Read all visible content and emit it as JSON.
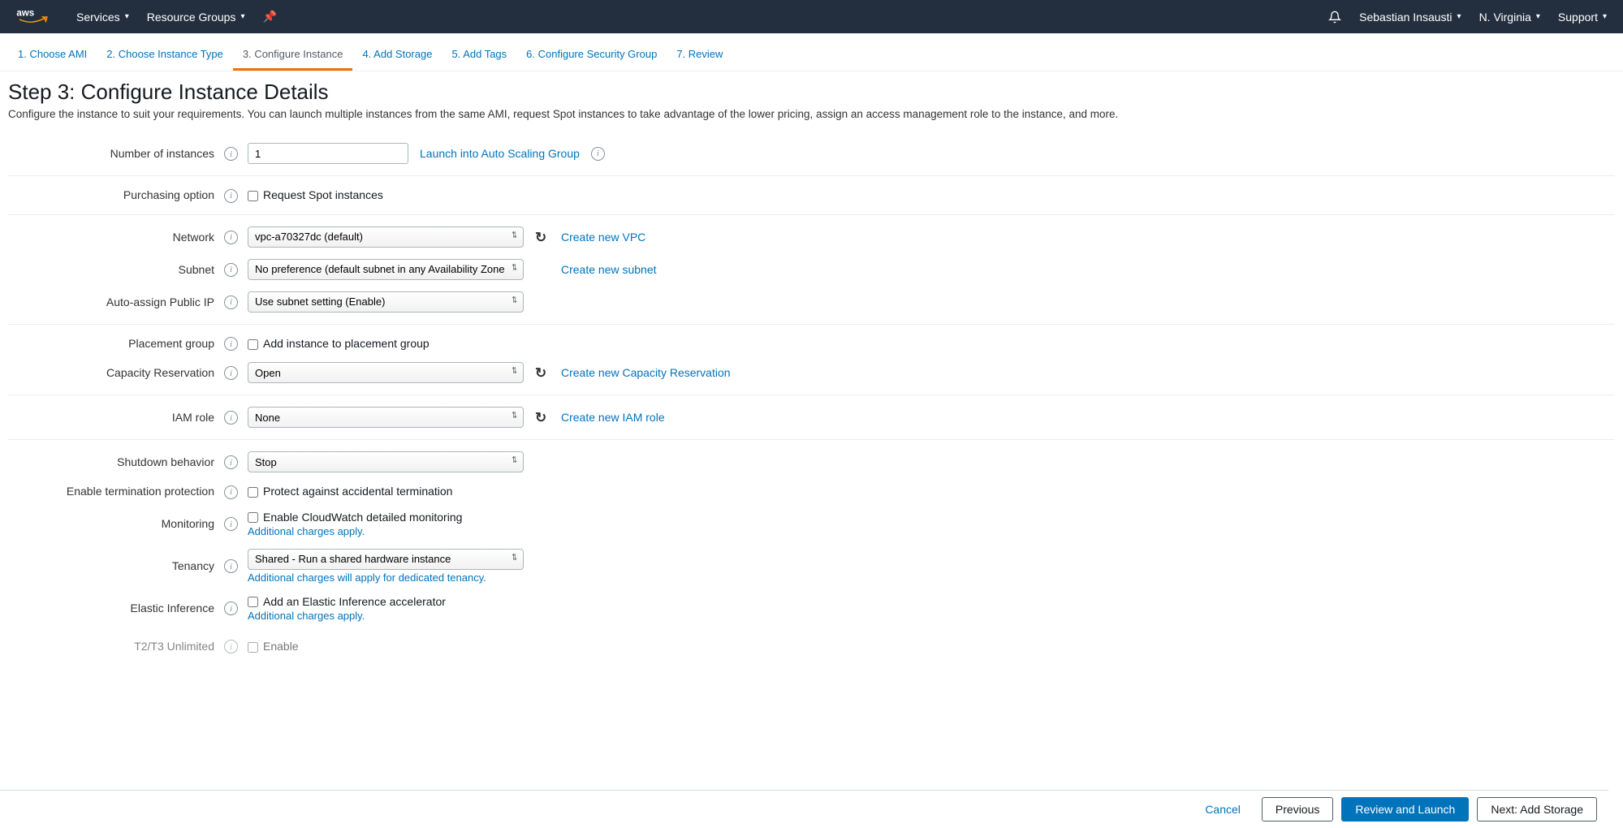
{
  "topbar": {
    "services_label": "Services",
    "resource_groups_label": "Resource Groups",
    "user_label": "Sebastian Insausti",
    "region_label": "N. Virginia",
    "support_label": "Support"
  },
  "wizard": {
    "tabs": [
      {
        "label": "1. Choose AMI"
      },
      {
        "label": "2. Choose Instance Type"
      },
      {
        "label": "3. Configure Instance"
      },
      {
        "label": "4. Add Storage"
      },
      {
        "label": "5. Add Tags"
      },
      {
        "label": "6. Configure Security Group"
      },
      {
        "label": "7. Review"
      }
    ]
  },
  "page": {
    "title": "Step 3: Configure Instance Details",
    "description": "Configure the instance to suit your requirements. You can launch multiple instances from the same AMI, request Spot instances to take advantage of the lower pricing, assign an access management role to the instance, and more."
  },
  "fields": {
    "num_instances": {
      "label": "Number of instances",
      "value": "1",
      "asg_link": "Launch into Auto Scaling Group"
    },
    "purchasing": {
      "label": "Purchasing option",
      "text": "Request Spot instances"
    },
    "network": {
      "label": "Network",
      "value": "vpc-a70327dc (default)",
      "link": "Create new VPC"
    },
    "subnet": {
      "label": "Subnet",
      "value": "No preference (default subnet in any Availability Zone)",
      "link": "Create new subnet"
    },
    "auto_ip": {
      "label": "Auto-assign Public IP",
      "value": "Use subnet setting (Enable)"
    },
    "placement": {
      "label": "Placement group",
      "text": "Add instance to placement group"
    },
    "capacity": {
      "label": "Capacity Reservation",
      "value": "Open",
      "link": "Create new Capacity Reservation"
    },
    "iam": {
      "label": "IAM role",
      "value": "None",
      "link": "Create new IAM role"
    },
    "shutdown": {
      "label": "Shutdown behavior",
      "value": "Stop"
    },
    "termination": {
      "label": "Enable termination protection",
      "text": "Protect against accidental termination"
    },
    "monitoring": {
      "label": "Monitoring",
      "text": "Enable CloudWatch detailed monitoring",
      "note": "Additional charges apply."
    },
    "tenancy": {
      "label": "Tenancy",
      "value": "Shared - Run a shared hardware instance",
      "note": "Additional charges will apply for dedicated tenancy."
    },
    "elastic_inference": {
      "label": "Elastic Inference",
      "text": "Add an Elastic Inference accelerator",
      "note": "Additional charges apply."
    },
    "t2t3": {
      "label": "T2/T3 Unlimited",
      "text": "Enable"
    }
  },
  "footer": {
    "cancel": "Cancel",
    "previous": "Previous",
    "review": "Review and Launch",
    "next": "Next: Add Storage"
  }
}
